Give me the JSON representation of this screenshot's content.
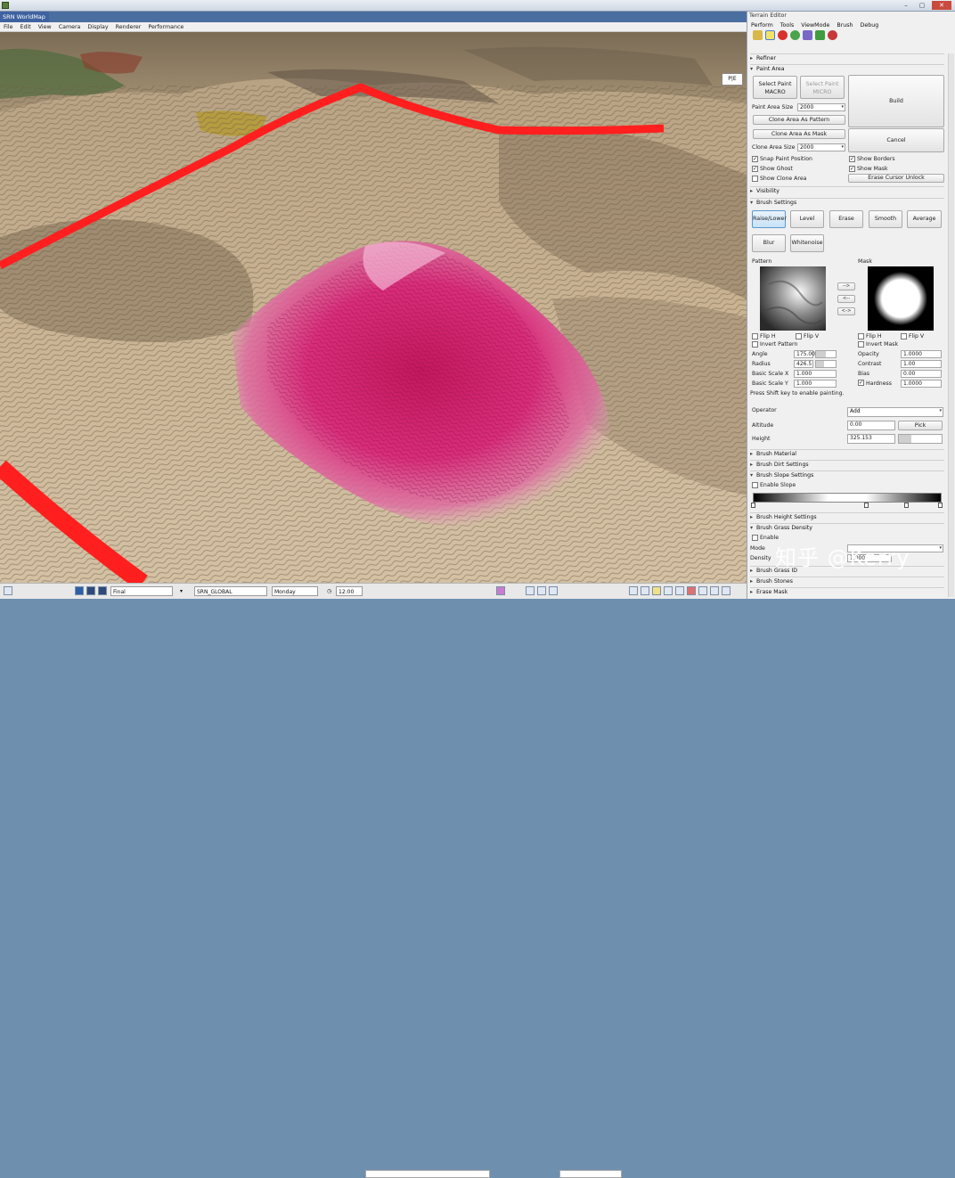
{
  "window": {
    "app_tab": "SRN WorldMap"
  },
  "menu": [
    "File",
    "Edit",
    "View",
    "Camera",
    "Display",
    "Renderer",
    "Performance"
  ],
  "viewport": {
    "badge": "P|E"
  },
  "statusbar": {
    "mode_value": "Final",
    "space_value": "SRN_GLOBAL",
    "day_value": "Monday",
    "time_value": "12:00"
  },
  "panel": {
    "title": "Terrain Editor",
    "menu": [
      "Perform",
      "Tools",
      "ViewMode",
      "Brush",
      "Debug"
    ],
    "sections": {
      "refiner": "Refiner",
      "paint_area": "Paint Area",
      "visibility": "Visibility",
      "brush_settings": "Brush Settings",
      "brush_material": "Brush Material",
      "brush_dirt": "Brush Dirt Settings",
      "brush_slope": "Brush Slope Settings",
      "brush_height": "Brush Height Settings",
      "brush_grass_density": "Brush Grass Density",
      "brush_grass_id": "Brush Grass ID",
      "brush_stones": "Brush Stones",
      "erase_mask": "Erase Mask"
    },
    "paint_area": {
      "select_macro_l1": "Select Paint",
      "select_macro_l2": "MACRO",
      "select_micro_l1": "Select Paint",
      "select_micro_l2": "MICRO",
      "build": "Build",
      "area_size_label": "Paint Area Size",
      "area_size_value": "2000",
      "clone_as_pattern": "Clone Area As Pattern",
      "clone_as_mask": "Clone Area As Mask",
      "clone_size_label": "Clone Area Size",
      "clone_size_value": "2000",
      "cancel": "Cancel",
      "snap_label": "Snap Paint Position",
      "snap_checked": "✓",
      "show_borders_label": "Show Borders",
      "show_borders_checked": "✓",
      "show_ghost_label": "Show Ghost",
      "show_ghost_checked": "✓",
      "show_mask_label": "Show Mask",
      "show_mask_checked": "✓",
      "show_clone_label": "Show Clone Area",
      "erase_unlock": "Erase Cursor Unlock"
    },
    "brush_settings": {
      "modes": [
        "Raise/Lower",
        "Level",
        "Erase",
        "Smooth",
        "Average",
        "Blur",
        "Whitenoise"
      ],
      "pattern_label": "Pattern",
      "mask_label": "Mask",
      "arrow_btns": [
        "-->",
        "<--",
        "<->"
      ],
      "flip_h": "Flip H",
      "flip_v": "Flip V",
      "invert_pattern": "Invert Pattern",
      "flip_h_mask": "Flip H",
      "flip_v_mask": "Flip V",
      "invert_mask": "Invert Mask",
      "angle_label": "Angle",
      "angle_value": "175.00",
      "radius_label": "Radius",
      "radius_value": "426.5",
      "basic_scale_x_label": "Basic Scale X",
      "basic_scale_x_value": "1.000",
      "basic_scale_y_label": "Basic Scale Y",
      "basic_scale_y_value": "1.000",
      "opacity_label": "Opacity",
      "opacity_value": "1.0000",
      "contrast_label": "Contrast",
      "contrast_value": "1.00",
      "bias_label": "Bias",
      "bias_value": "0.00",
      "hardness_label": "Hardness",
      "hardness_checked": "✓",
      "hardness_value": "1.0000",
      "hint": "Press Shift key to enable painting."
    },
    "operator": {
      "operator_label": "Operator",
      "operator_value": "Add",
      "altitude_label": "Altitude",
      "altitude_value": "0.00",
      "pick": "Pick",
      "height_label": "Height",
      "height_value": "325.153"
    },
    "slope": {
      "enable_label": "Enable Slope"
    },
    "grass": {
      "enable_label": "Enable",
      "mode_label": "Mode",
      "density_label": "Density",
      "density_value": "1.000"
    }
  },
  "watermark": "知乎 @Kerry",
  "colors": {
    "paint_area": "#e0307e",
    "road": "#ff1f1f",
    "selected_button": "#c7e2f7"
  }
}
